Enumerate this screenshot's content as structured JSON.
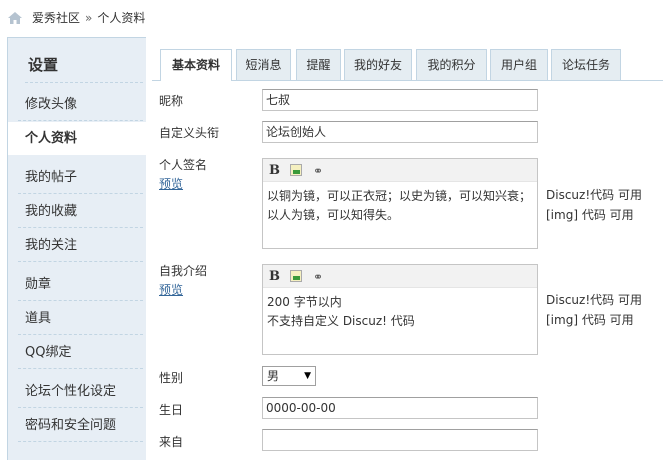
{
  "breadcrumb": {
    "home": "爱秀社区",
    "separator": "»",
    "current": "个人资料"
  },
  "sidebar": {
    "title": "设置",
    "items": [
      {
        "label": "修改头像"
      },
      {
        "label": "个人资料"
      },
      {
        "label": "我的帖子"
      },
      {
        "label": "我的收藏"
      },
      {
        "label": "我的关注"
      },
      {
        "label": "勋章"
      },
      {
        "label": "道具"
      },
      {
        "label": "QQ绑定"
      },
      {
        "label": "论坛个性化设定"
      },
      {
        "label": "密码和安全问题"
      }
    ]
  },
  "tabs": [
    {
      "label": "基本资料"
    },
    {
      "label": "短消息"
    },
    {
      "label": "提醒"
    },
    {
      "label": "我的好友"
    },
    {
      "label": "我的积分"
    },
    {
      "label": "用户组"
    },
    {
      "label": "论坛任务"
    }
  ],
  "form": {
    "nickname": {
      "label": "昵称",
      "value": "七叔"
    },
    "custom_title": {
      "label": "自定义头衔",
      "value": "论坛创始人"
    },
    "signature": {
      "label": "个人签名",
      "preview": "预览",
      "line1": "以铜为镜，可以正衣冠；以史为镜，可以知兴衰；",
      "line2": "以人为镜，可以知得失。",
      "hint1": "Discuz!代码 可用",
      "hint2": "[img] 代码 可用"
    },
    "intro": {
      "label": "自我介绍",
      "preview": "预览",
      "line1": "200 字节以内",
      "line2": "不支持自定义 Discuz! 代码",
      "hint1": "Discuz!代码 可用",
      "hint2": "[img] 代码 可用"
    },
    "gender": {
      "label": "性别",
      "value": "男"
    },
    "birthday": {
      "label": "生日",
      "value": "0000-00-00"
    },
    "from": {
      "label": "来自",
      "value": ""
    }
  },
  "toolbar": {
    "bold": "B",
    "link": "⚭"
  },
  "colors": {
    "sidebar_bg": "#e7eef5",
    "border": "#c2d5e3",
    "tab_bg": "#e5edf2",
    "link": "#336699"
  }
}
